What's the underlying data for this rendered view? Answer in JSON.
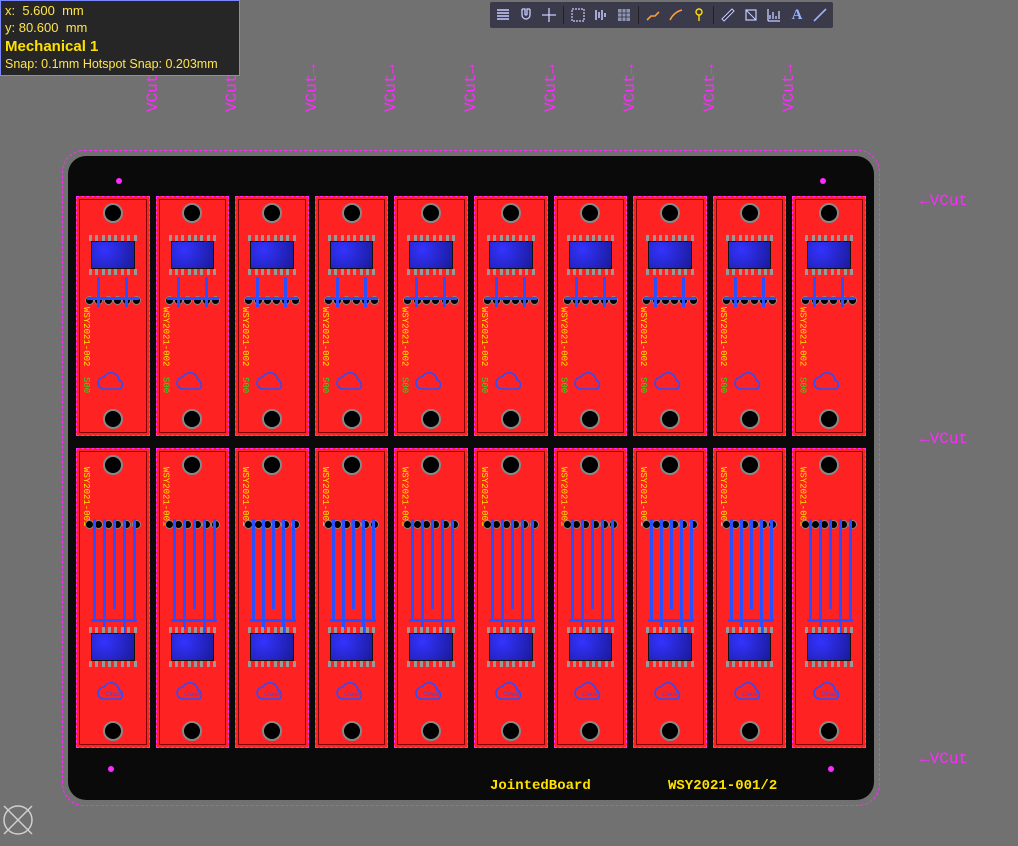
{
  "status": {
    "x_label": "x:  5.600  mm",
    "y_label": "y: 80.600  mm",
    "layer": "Mechanical 1",
    "snap": "Snap: 0.1mm Hotspot Snap: 0.203mm"
  },
  "board": {
    "footer_left": "JointedBoard",
    "footer_right": "WSY2021-001/2",
    "part_top": "WSY2021-002",
    "part_top_green": "S00",
    "part_bot": "WSY2021-001",
    "cloud_label": "Cloud"
  },
  "vcut": {
    "label": "VCut"
  },
  "toolbar": {
    "items": [
      "hand",
      "magnet",
      "crosshair",
      "sep",
      "select-rect",
      "align",
      "grid-fill",
      "sep",
      "route",
      "route-curve",
      "pin",
      "sep",
      "measure",
      "crop",
      "chart",
      "text",
      "line"
    ]
  }
}
